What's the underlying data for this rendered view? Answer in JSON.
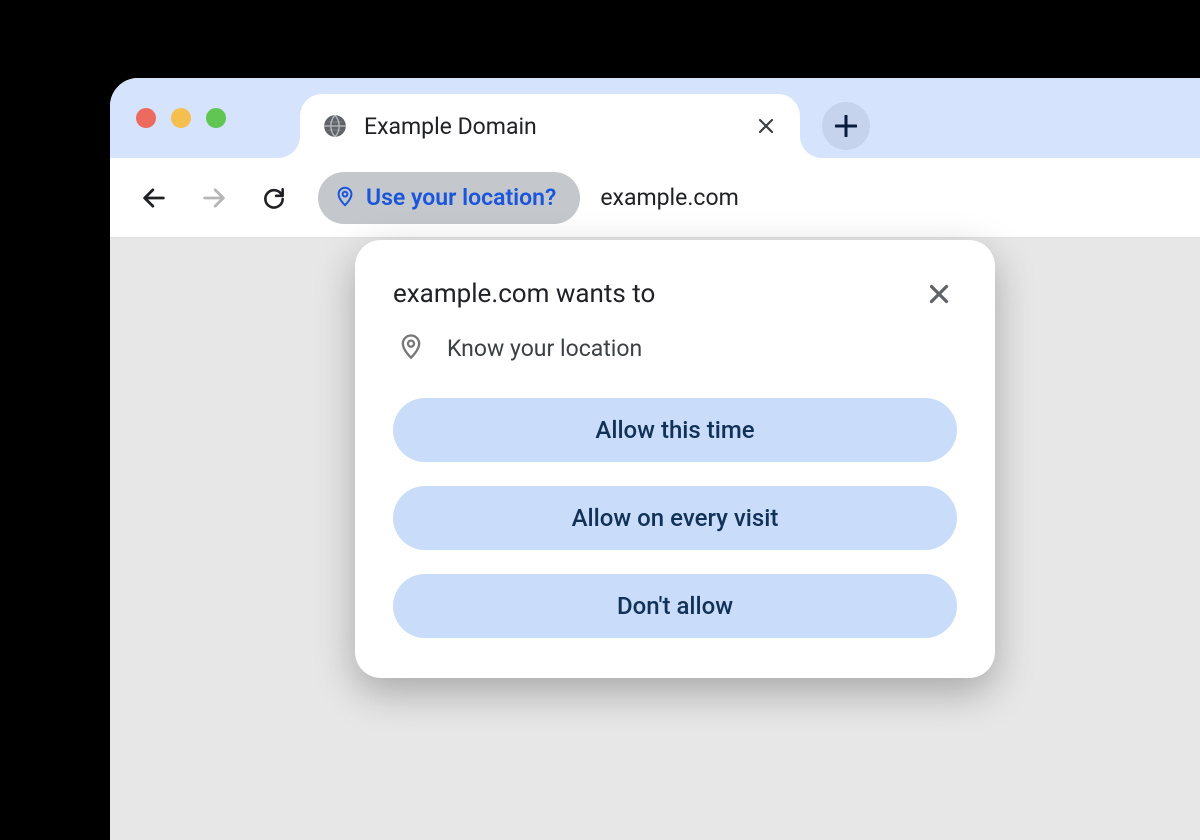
{
  "tab": {
    "title": "Example Domain"
  },
  "address_bar": {
    "chip_label": "Use your location?",
    "url": "example.com"
  },
  "permission_dialog": {
    "title": "example.com wants to",
    "permission_text": "Know your location",
    "buttons": {
      "allow_once": "Allow this time",
      "allow_always": "Allow on every visit",
      "deny": "Don't allow"
    }
  }
}
